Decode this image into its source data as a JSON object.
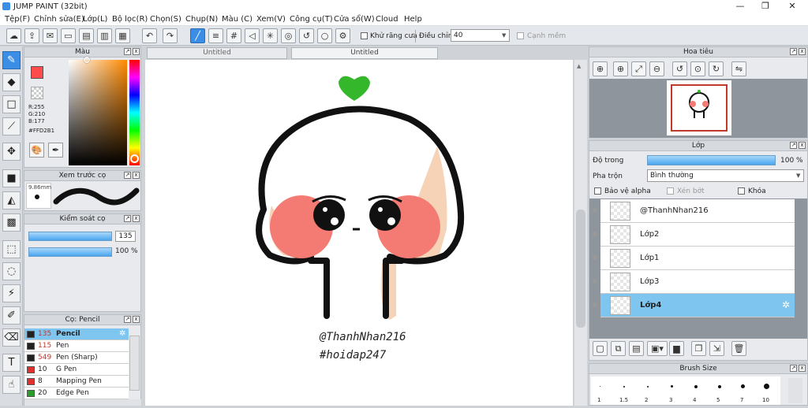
{
  "app": {
    "title": "JUMP PAINT (32bit)",
    "min": "—",
    "max": "❐",
    "close": "✕"
  },
  "menu": [
    "Tệp(F)",
    "Chỉnh sửa(E)",
    "Lớp(L)",
    "Bộ lọc(R)",
    "Chọn(S)",
    "Chụp(N)",
    "Màu (C)",
    "Xem(V)",
    "Công cụ(T)",
    "Cửa sổ(W)",
    "Cloud",
    "Help"
  ],
  "toolbar": {
    "antialias": "Khử răng cưa",
    "adjust": "Điều chỉnh",
    "adjust_value": "40",
    "snap": "Cạnh mềm"
  },
  "color_panel": {
    "title": "Màu",
    "r": "R:255",
    "g": "G:210",
    "b": "B:177",
    "hex": "#FFD2B1",
    "primary": "#ff4b4b",
    "secondary": "#ffd2b1"
  },
  "preview_panel": {
    "title": "Xem trước cọ",
    "size": "9.86mm"
  },
  "brush_control": {
    "title": "Kiểm soát cọ",
    "size": "135",
    "opacity": "100 %"
  },
  "brush_list": {
    "title": "Cọ: Pencil",
    "items": [
      {
        "size": "135",
        "name": "Pencil",
        "color": "#222222"
      },
      {
        "size": "115",
        "name": "Pen",
        "color": "#222222"
      },
      {
        "size": "549",
        "name": "Pen (Sharp)",
        "color": "#222222"
      },
      {
        "size": "10",
        "name": "G Pen",
        "color": "#e03030"
      },
      {
        "size": "8",
        "name": "Mapping Pen",
        "color": "#e03030"
      },
      {
        "size": "20",
        "name": "Edge Pen",
        "color": "#2a9d2a"
      }
    ]
  },
  "tabs": [
    "Untitled",
    "Untitled"
  ],
  "canvas_text": {
    "line1": "@ThanhNhan216",
    "line2": "#hoidap247"
  },
  "navigator": {
    "title": "Hoa tiêu"
  },
  "layer_panel": {
    "title": "Lớp",
    "opacity_label": "Độ trong",
    "opacity_value": "100 %",
    "blend_label": "Pha trộn",
    "blend_value": "Bình thường",
    "protect_alpha": "Bảo vệ alpha",
    "clip": "Xén bớt",
    "lock": "Khóa",
    "layers": [
      {
        "name": "@ThanhNhan216"
      },
      {
        "name": "Lớp2"
      },
      {
        "name": "Lớp1"
      },
      {
        "name": "Lớp3"
      },
      {
        "name": "Lớp4"
      }
    ]
  },
  "brush_size": {
    "title": "Brush Size",
    "sizes": [
      "1",
      "1.5",
      "2",
      "3",
      "4",
      "5",
      "7",
      "10"
    ]
  }
}
